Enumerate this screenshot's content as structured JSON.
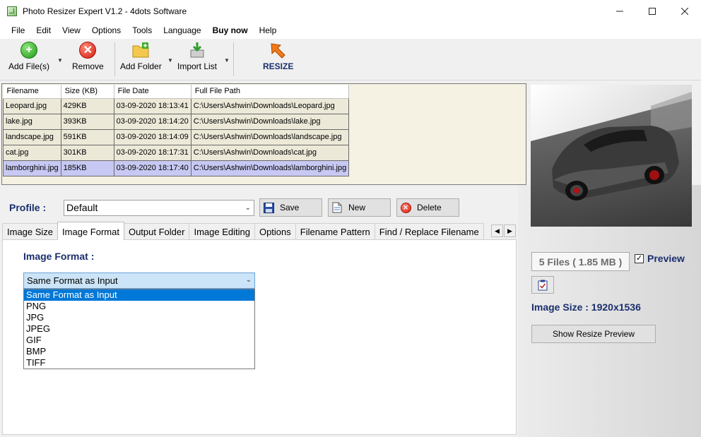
{
  "window": {
    "title": "Photo Resizer Expert V1.2 - 4dots Software"
  },
  "menu": [
    "File",
    "Edit",
    "View",
    "Options",
    "Tools",
    "Language",
    "Buy now",
    "Help"
  ],
  "toolbar": {
    "add_files": "Add File(s)",
    "remove": "Remove",
    "add_folder": "Add Folder",
    "import_list": "Import List",
    "resize": "RESIZE"
  },
  "files": {
    "columns": [
      "Filename",
      "Size (KB)",
      "File Date",
      "Full File Path"
    ],
    "rows": [
      [
        "Leopard.jpg",
        "429KB",
        "03-09-2020 18:13:41",
        "C:\\Users\\Ashwin\\Downloads\\Leopard.jpg"
      ],
      [
        "lake.jpg",
        "393KB",
        "03-09-2020 18:14:20",
        "C:\\Users\\Ashwin\\Downloads\\lake.jpg"
      ],
      [
        "landscape.jpg",
        "591KB",
        "03-09-2020 18:14:09",
        "C:\\Users\\Ashwin\\Downloads\\landscape.jpg"
      ],
      [
        "cat.jpg",
        "301KB",
        "03-09-2020 18:17:31",
        "C:\\Users\\Ashwin\\Downloads\\cat.jpg"
      ],
      [
        "lamborghini.jpg",
        "185KB",
        "03-09-2020 18:17:40",
        "C:\\Users\\Ashwin\\Downloads\\lamborghini.jpg"
      ]
    ],
    "selected_index": 4
  },
  "profile": {
    "label": "Profile :",
    "value": "Default",
    "save": "Save",
    "new": "New",
    "delete": "Delete"
  },
  "tabs": [
    "Image Size",
    "Image Format",
    "Output Folder",
    "Image Editing",
    "Options",
    "Filename Pattern",
    "Find / Replace Filename"
  ],
  "active_tab": 1,
  "image_format": {
    "label": "Image Format  :",
    "selected": "Same Format as Input",
    "options": [
      "Same Format as Input",
      "PNG",
      "JPG",
      "JPEG",
      "GIF",
      "BMP",
      "TIFF"
    ]
  },
  "preview": {
    "files_summary": "5 Files ( 1.85 MB )",
    "preview_label": "Preview",
    "preview_checked": true,
    "image_size": "Image Size : 1920x1536",
    "show_preview_button": "Show Resize Preview"
  },
  "colors": {
    "accent_blue": "#1a2e6d",
    "selection": "#0078d7"
  }
}
